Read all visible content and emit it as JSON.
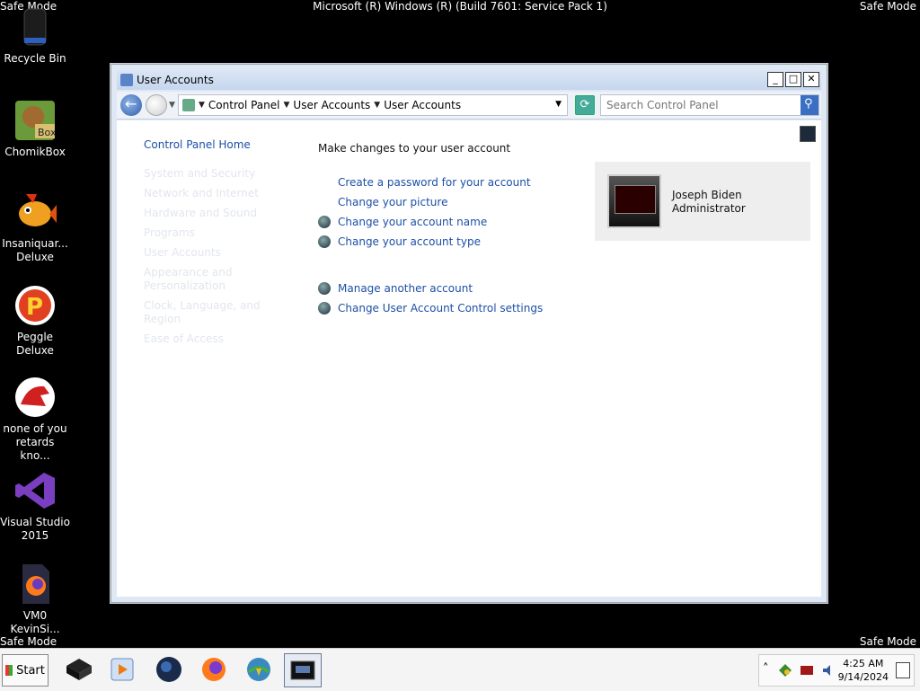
{
  "os": {
    "title": "Microsoft (R) Windows (R) (Build 7601: Service Pack 1)",
    "safe_mode": "Safe Mode"
  },
  "desktop": {
    "icons": [
      {
        "label": "Recycle Bin"
      },
      {
        "label": "ChomikBox"
      },
      {
        "label": "Insaniquar... Deluxe"
      },
      {
        "label": "Peggle Deluxe"
      },
      {
        "label": "none of you retards kno..."
      },
      {
        "label": "Visual Studio 2015"
      },
      {
        "label": "VM0 KevinSi..."
      }
    ]
  },
  "window": {
    "title": "User Accounts",
    "min": "_",
    "max": "□",
    "close": "✕",
    "breadcrumb": [
      "Control Panel",
      "User Accounts",
      "User Accounts"
    ],
    "search_placeholder": "Search Control Panel",
    "left_nav": {
      "home": "Control Panel Home",
      "faded": [
        "System and Security",
        "Network and Internet",
        "Hardware and Sound",
        "Programs",
        "User Accounts",
        "Appearance and Personalization",
        "Clock, Language, and Region",
        "Ease of Access"
      ]
    },
    "heading": "Make changes to your user account",
    "tasks_group1": [
      {
        "label": "Create a password for your account",
        "bullet": false
      },
      {
        "label": "Change your picture",
        "bullet": false
      },
      {
        "label": "Change your account name",
        "bullet": true
      },
      {
        "label": "Change your account type",
        "bullet": true
      }
    ],
    "tasks_group2": [
      {
        "label": "Manage another account",
        "bullet": true
      },
      {
        "label": "Change User Account Control settings",
        "bullet": true
      }
    ],
    "account": {
      "name": "Joseph Biden",
      "role": "Administrator"
    }
  },
  "taskbar": {
    "start": "Start",
    "time": "4:25 AM",
    "date": "9/14/2024"
  }
}
